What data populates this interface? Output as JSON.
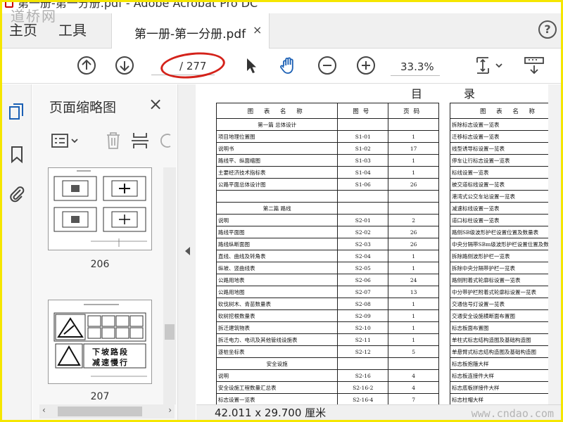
{
  "window": {
    "title": "第一册-第一分册.pdf - Adobe Acrobat Pro DC"
  },
  "watermarks": {
    "top_left": "道桥网",
    "bottom_right": "www.cndao.com"
  },
  "tabs": {
    "home": "主页",
    "tools": "工具",
    "document": "第一册-第一分册.pdf",
    "close_glyph": "×",
    "help_glyph": "?"
  },
  "toolbar": {
    "page_total": "/ 277",
    "zoom": "33.3%"
  },
  "thumbnails": {
    "title": "页面缩略图",
    "close_glyph": "×",
    "pages": [
      {
        "number": "206"
      },
      {
        "number": "207"
      }
    ],
    "thumb207_sign1": "下坡路段",
    "thumb207_sign2": "减速慢行"
  },
  "status": {
    "page_size": "42.011 x 29.700 厘米"
  },
  "document": {
    "heading_left": "目",
    "heading_right": "录",
    "left_headers": [
      "图 表 名 称",
      "图号",
      "页码"
    ],
    "left_rows": [
      {
        "name": "第一篇   总体设计",
        "num": "",
        "page": "",
        "section": true
      },
      {
        "name": "项目地理位置图",
        "num": "S1-01",
        "page": "1"
      },
      {
        "name": "说明书",
        "num": "S1-02",
        "page": "17"
      },
      {
        "name": "路线平、纵面缩图",
        "num": "S1-03",
        "page": "1"
      },
      {
        "name": "主要经济技术指标表",
        "num": "S1-04",
        "page": "1"
      },
      {
        "name": "公路平面总体设计图",
        "num": "S1-06",
        "page": "26"
      },
      {
        "name": "",
        "num": "",
        "page": ""
      },
      {
        "name": "第二篇  路线",
        "num": "",
        "page": "",
        "section": true
      },
      {
        "name": "说明",
        "num": "S2-01",
        "page": "2"
      },
      {
        "name": "路线平面图",
        "num": "S2-02",
        "page": "26"
      },
      {
        "name": "路线纵断面图",
        "num": "S2-03",
        "page": "26"
      },
      {
        "name": "直线、曲线及转角表",
        "num": "S2-04",
        "page": "1"
      },
      {
        "name": "纵坡、竖曲线表",
        "num": "S2-05",
        "page": "1"
      },
      {
        "name": "公路用地表",
        "num": "S2-06",
        "page": "24"
      },
      {
        "name": "公路用地图",
        "num": "S2-07",
        "page": "13"
      },
      {
        "name": "砍伐树木、青苗数量表",
        "num": "S2-08",
        "page": "1"
      },
      {
        "name": "砍树挖根数量表",
        "num": "S2-09",
        "page": "1"
      },
      {
        "name": "拆迁建筑物表",
        "num": "S2-10",
        "page": "1"
      },
      {
        "name": "拆迁电力、电讯及其他管线设施表",
        "num": "S2-11",
        "page": "1"
      },
      {
        "name": "逐桩坐标表",
        "num": "S2-12",
        "page": "5"
      },
      {
        "name": "安全设施",
        "num": "",
        "page": "",
        "section": true
      },
      {
        "name": "说明",
        "num": "S2-16",
        "page": "4"
      },
      {
        "name": "安全设施工程数量汇总表",
        "num": "S2-16-2",
        "page": "4"
      },
      {
        "name": "标志设置一览表",
        "num": "S2-16-4",
        "page": "7"
      }
    ],
    "right_header": "图 表 名 称",
    "right_rows": [
      "拆除标志设置一览表",
      "迁移标志设置一览表",
      "线型诱导标设置一览表",
      "停车让行标志设置一览表",
      "标线设置一览表",
      "被交道标线设置一览表",
      "港湾式公交车站设置一览表",
      "减速标线设置一览表",
      "道口标柱设置一览表",
      "路侧SB级波形护栏设置位置及数量表",
      "中央分隔带SBm级波形护栏设置位置及数量表",
      "拆除路侧波形护栏一览表",
      "拆除中央分隔带护栏一览表",
      "路侧附着式轮廓标设置一览表",
      "中分带护栏附着式轮廓标设置一览表",
      "交通信号灯设置一览表",
      "交通安全设施横断面布置图",
      "标志板面布置图",
      "单柱式标志结构造图及基础构造图",
      "单悬臂式标志结构造图及基础构造图",
      "标志板抱箍大样",
      "标志板连接件大样",
      "标志底板拼接件大样",
      "标志柱帽大样"
    ]
  }
}
